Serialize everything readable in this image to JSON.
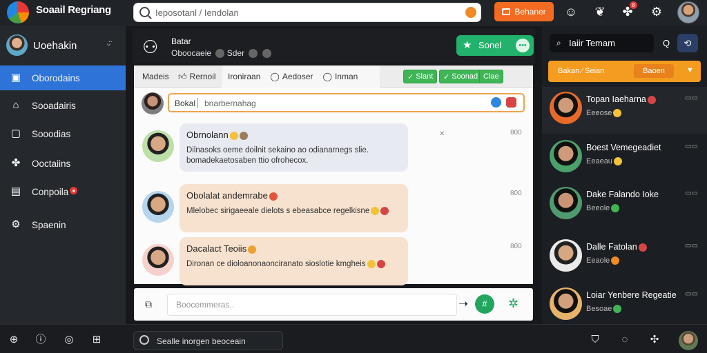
{
  "app": {
    "title": "Soaail Regriang"
  },
  "topbar": {
    "search_placeholder": "Ieposotanl / Iendolan",
    "cta_label": "Behaner",
    "notif_count": "8"
  },
  "sidebar": {
    "profile_name": "Uoehakin",
    "items": [
      {
        "label": "Oborodains",
        "icon": "dashboard-icon"
      },
      {
        "label": "Sooadairis",
        "icon": "megaphone-icon"
      },
      {
        "label": "Sooodias",
        "icon": "folder-icon"
      },
      {
        "label": "Ooctaiins",
        "icon": "puzzle-icon"
      },
      {
        "label": "Conpoila",
        "icon": "chat-icon",
        "badge": "●"
      },
      {
        "label": "Spaenin",
        "icon": "settings-icon"
      }
    ]
  },
  "main": {
    "group_name": "Batar",
    "group_sub": "Oboocaeie",
    "group_sub_extra": "Sder",
    "join_label": "Sonel",
    "tabs": [
      {
        "label": "Madeis"
      },
      {
        "label": "Rernoil"
      },
      {
        "label": "Ironiraan"
      },
      {
        "label": "Aedoser"
      },
      {
        "label": "Inman"
      }
    ],
    "pills": [
      "Slant",
      "Soonad",
      "Clae"
    ],
    "composer": {
      "label": "Bokal",
      "placeholder": "bnarbernahag"
    },
    "posts": [
      {
        "title": "Obrnolann",
        "body": "Dilnasoks oeme doilnit sekaino ao odianarnegs slie. bomadekaetosaben ttio ofrohecox.",
        "time": "800",
        "style": "gray"
      },
      {
        "title": "Obolalat andemrabe",
        "body": "Mlelobec sirigaeeale dielots s ebeasabce regelkisne",
        "time": "800",
        "style": "peach"
      },
      {
        "title": "Dacalact Teoiis",
        "body": "Dironan ce dioloanonaonciranato sioslotie kmgheis",
        "time": "800",
        "style": "peach"
      }
    ],
    "message_placeholder": "Boocemmeras.."
  },
  "right": {
    "search_text": "Iaiir Temam",
    "promo_label": "Bakan ∕ Seian",
    "promo_btn": "Baoen",
    "contacts": [
      {
        "name": "Topan Iaeharna",
        "status": "Eeeose"
      },
      {
        "name": "Boest Vemegeadiet",
        "status": "Eeaeau"
      },
      {
        "name": "Dake Falando Ioke",
        "status": "Beeole"
      },
      {
        "name": "Dalle Fatolan",
        "status": "Eeaole"
      },
      {
        "name": "Loiar Yenbere Regeatie",
        "status": "Besoae"
      }
    ]
  },
  "bottombar": {
    "search_text": "Sealle inorgen beoceain"
  },
  "colors": {
    "accent": "#2e73d8",
    "cta": "#f26b21",
    "join": "#22b26b",
    "promo": "#f39c1f"
  }
}
